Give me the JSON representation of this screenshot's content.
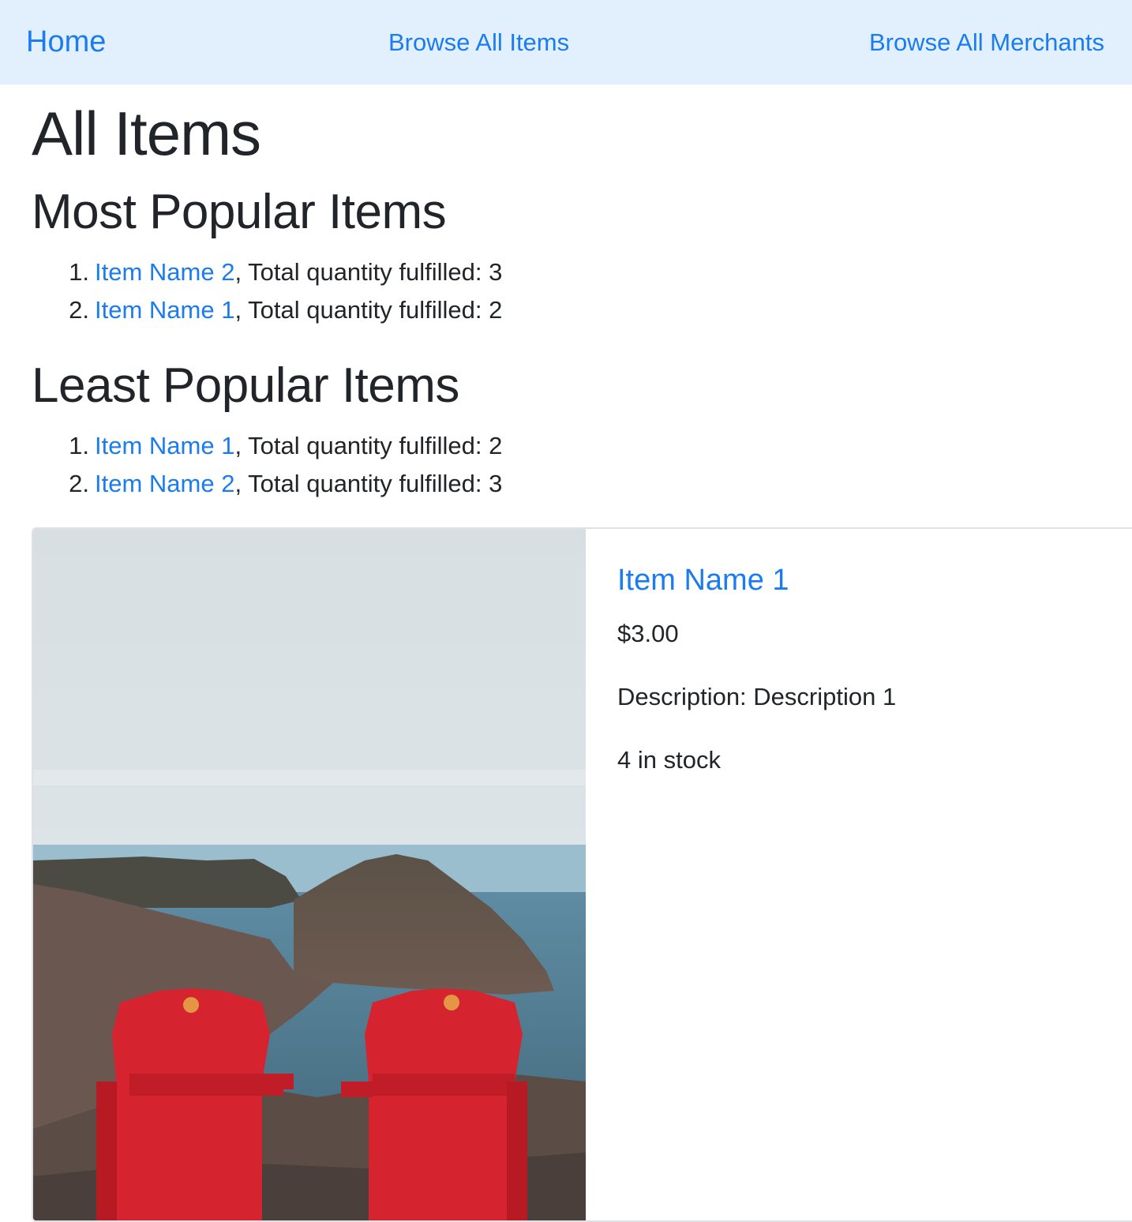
{
  "nav": {
    "home": "Home",
    "browse_items": "Browse All Items",
    "browse_merchants": "Browse All Merchants"
  },
  "page_title": "All Items",
  "most_popular": {
    "title": "Most Popular Items",
    "items": [
      {
        "rank": "1.",
        "name": "Item Name 2",
        "detail": ", Total quantity fulfilled: 3"
      },
      {
        "rank": "2.",
        "name": "Item Name 1",
        "detail": ", Total quantity fulfilled: 2"
      }
    ]
  },
  "least_popular": {
    "title": "Least Popular Items",
    "items": [
      {
        "rank": "1.",
        "name": "Item Name 1",
        "detail": ", Total quantity fulfilled: 2"
      },
      {
        "rank": "2.",
        "name": "Item Name 2",
        "detail": ", Total quantity fulfilled: 3"
      }
    ]
  },
  "item_card": {
    "name": "Item Name 1",
    "price": "$3.00",
    "description": "Description: Description 1",
    "stock": "4 in stock",
    "image_subject": "red chairs on coastal cliff"
  },
  "colors": {
    "link": "#1a7cf0",
    "navbar_bg": "#e1f0fc",
    "text": "#212529"
  }
}
